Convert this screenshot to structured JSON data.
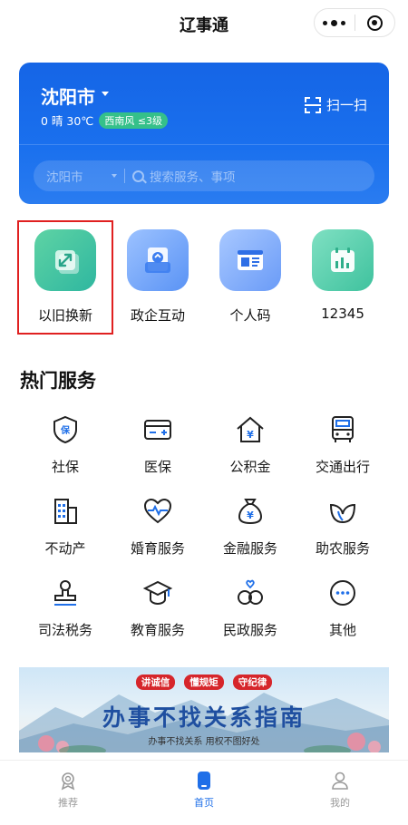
{
  "topbar": {
    "title": "辽事通"
  },
  "header": {
    "city": "沈阳市",
    "weather_text": "0 晴 30℃",
    "wind_badge": "西南风 ≤3级",
    "scan_label": "扫一扫",
    "search_city": "沈阳市",
    "search_placeholder": "搜索服务、事项"
  },
  "quick": [
    {
      "label": "以旧换新",
      "icon": "swap-arrows-icon"
    },
    {
      "label": "政企互动",
      "icon": "chat-document-icon"
    },
    {
      "label": "个人码",
      "icon": "personal-code-icon"
    },
    {
      "label": "12345",
      "icon": "calendar-chart-icon"
    }
  ],
  "hot": {
    "title": "热门服务",
    "items": [
      {
        "label": "社保",
        "icon": "shield-icon"
      },
      {
        "label": "医保",
        "icon": "medical-card-icon"
      },
      {
        "label": "公积金",
        "icon": "house-yen-icon"
      },
      {
        "label": "交通出行",
        "icon": "bus-icon"
      },
      {
        "label": "不动产",
        "icon": "building-icon"
      },
      {
        "label": "婚育服务",
        "icon": "heart-pulse-icon"
      },
      {
        "label": "金融服务",
        "icon": "money-bag-icon"
      },
      {
        "label": "助农服务",
        "icon": "leaf-icon"
      },
      {
        "label": "司法税务",
        "icon": "stamp-icon"
      },
      {
        "label": "教育服务",
        "icon": "graduation-cap-icon"
      },
      {
        "label": "民政服务",
        "icon": "rings-icon"
      },
      {
        "label": "其他",
        "icon": "more-icon"
      }
    ]
  },
  "banner": {
    "tags": [
      "讲诚信",
      "懂规矩",
      "守纪律"
    ],
    "headline": "办事不找关系指南",
    "subtitle": "办事不找关系    用权不图好处"
  },
  "tabbar": [
    {
      "label": "推荐",
      "icon": "medal-icon"
    },
    {
      "label": "首页",
      "icon": "home-icon"
    },
    {
      "label": "我的",
      "icon": "person-icon"
    }
  ],
  "colors": {
    "primary": "#1a6ff0",
    "highlight_border": "#e02020",
    "wind_badge": "#35c08a"
  }
}
